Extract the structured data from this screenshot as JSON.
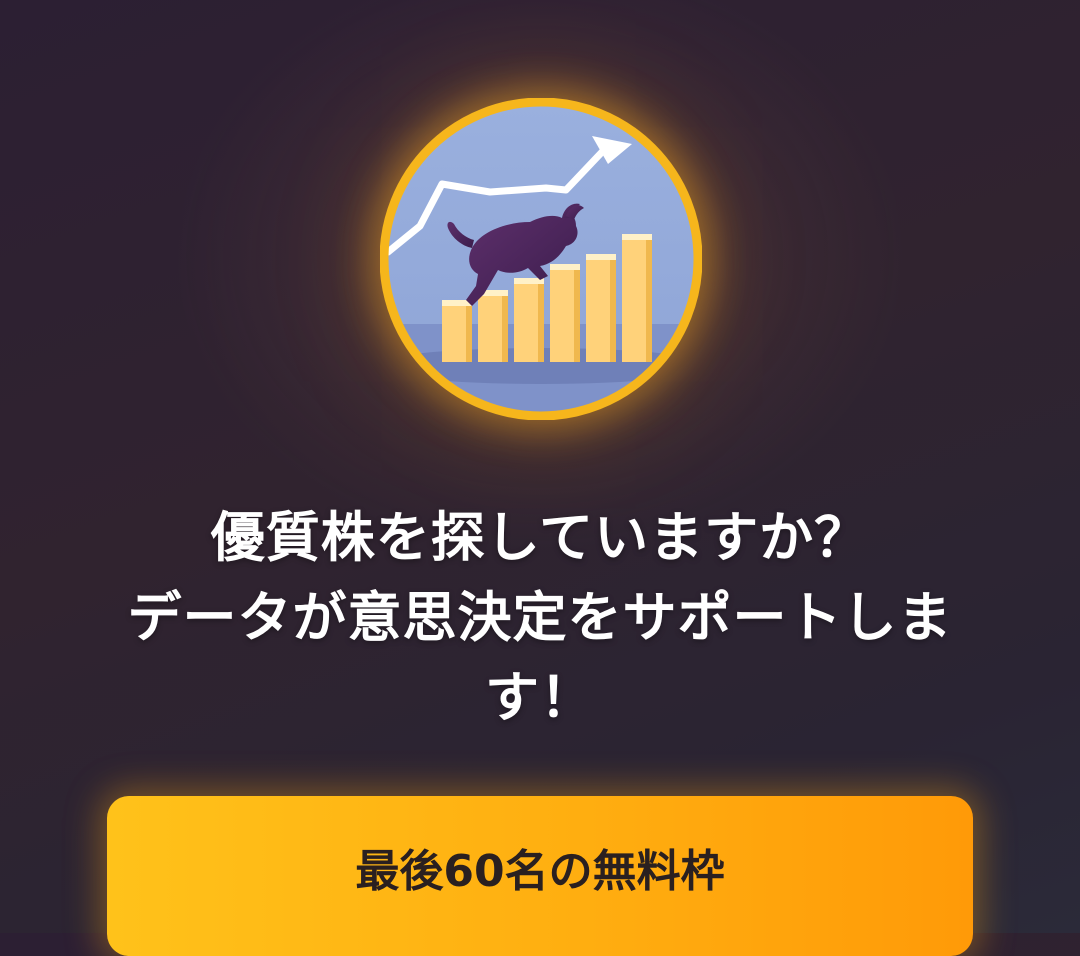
{
  "hero": {
    "icon": "bull-market-chart-icon",
    "ring_color": "#f6b61c",
    "sky_color": "#8fa7d8",
    "bar_color": "#ffd27a"
  },
  "headline": {
    "line1": "優質株を探していますか？",
    "line2": "データが意思決定をサポートしま",
    "line3": "す！"
  },
  "cta": {
    "label": "最後60名の無料枠",
    "color": "#ffb312"
  }
}
